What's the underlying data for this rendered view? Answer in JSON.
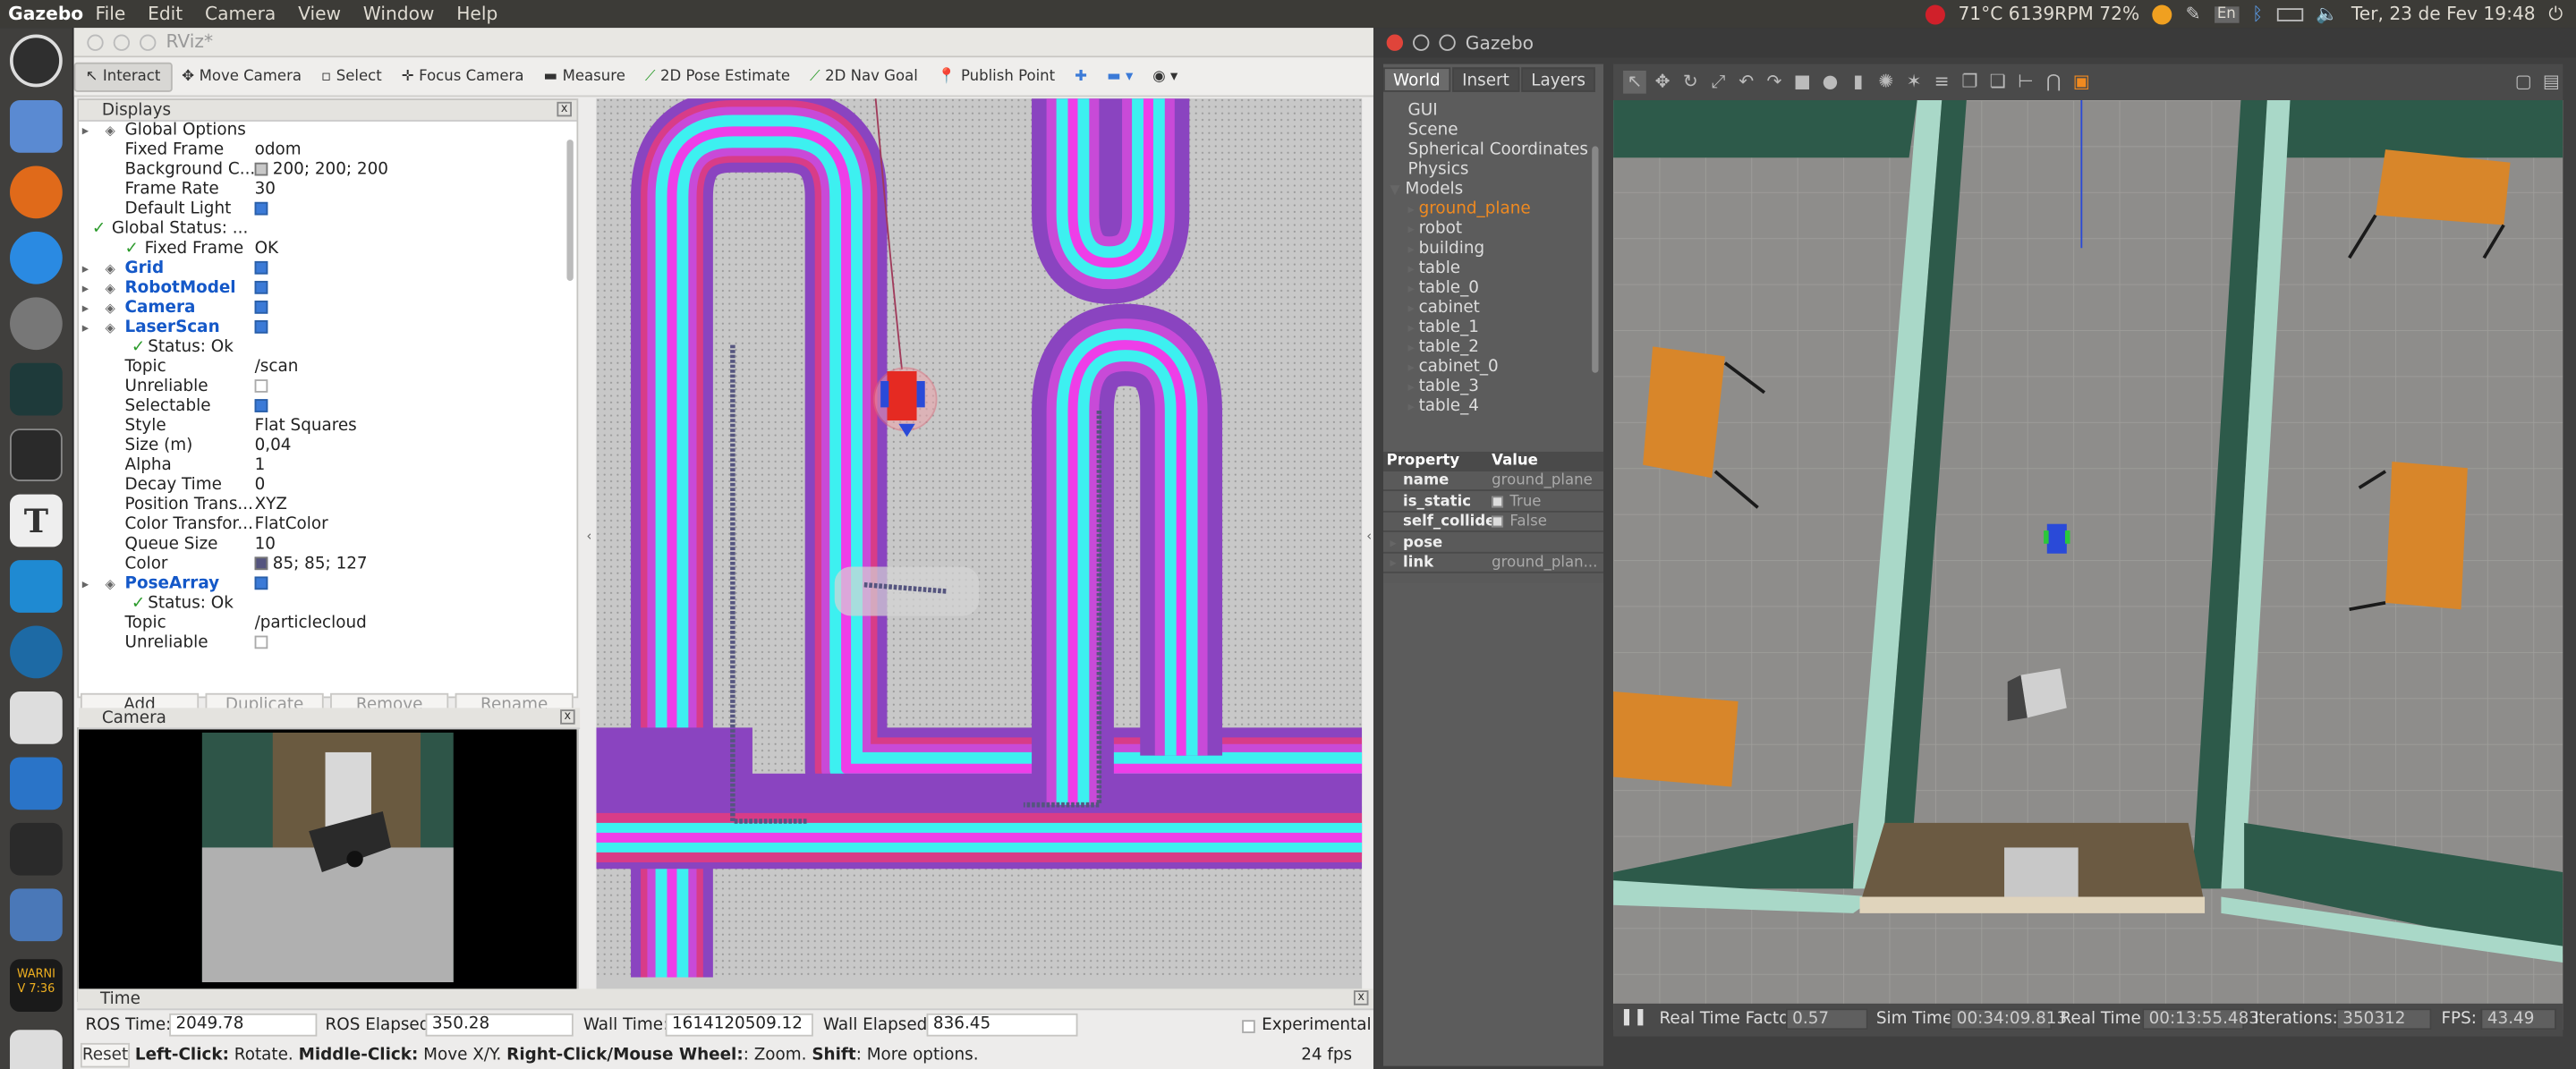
{
  "topbar": {
    "app": "Gazebo",
    "menus": [
      "File",
      "Edit",
      "Camera",
      "View",
      "Window",
      "Help"
    ],
    "sensors": "71°C 6139RPM 72%",
    "keyboard": "En",
    "datetime": "Ter, 23 de Fev 19:48"
  },
  "launcher": {
    "icons": [
      "ubuntu-dash-icon",
      "files-icon",
      "firefox-icon",
      "app-store-icon",
      "settings-icon",
      "system-monitor-icon",
      "terminal-icon",
      "text-editor-icon",
      "vscode-icon",
      "inkscape-icon",
      "gedit-icon",
      "thunderbird-icon",
      "geogebra-icon",
      "screenshot-icon",
      "warning-icon",
      "monitor-icon"
    ],
    "warning_text": "WARNI\nV 7:36"
  },
  "rviz": {
    "title": "RViz*",
    "toolbar": [
      "Interact",
      "Move Camera",
      "Select",
      "Focus Camera",
      "Measure",
      "2D Pose Estimate",
      "2D Nav Goal",
      "Publish Point"
    ],
    "displays_title": "Displays",
    "rows": [
      {
        "k": "Global Options",
        "v": "",
        "t": "section"
      },
      {
        "k": "Fixed Frame",
        "v": "odom"
      },
      {
        "k": "Background C...",
        "v": "200; 200; 200",
        "swatch": "#c8c8c8"
      },
      {
        "k": "Frame Rate",
        "v": "30"
      },
      {
        "k": "Default Light",
        "v": "",
        "cb": true
      },
      {
        "k": "Global Status: ...",
        "v": "",
        "t": "check"
      },
      {
        "k": "Fixed Frame",
        "v": "OK",
        "t": "check2"
      },
      {
        "k": "Grid",
        "v": "",
        "t": "blue",
        "cb": true
      },
      {
        "k": "RobotModel",
        "v": "",
        "t": "blue",
        "cb": true
      },
      {
        "k": "Camera",
        "v": "",
        "t": "blue",
        "cb": true
      },
      {
        "k": "LaserScan",
        "v": "",
        "t": "blue",
        "cb": true
      },
      {
        "k": "Status: Ok",
        "v": "",
        "t": "check3"
      },
      {
        "k": "Topic",
        "v": "/scan"
      },
      {
        "k": "Unreliable",
        "v": "",
        "cbe": true
      },
      {
        "k": "Selectable",
        "v": "",
        "cb": true
      },
      {
        "k": "Style",
        "v": "Flat Squares"
      },
      {
        "k": "Size (m)",
        "v": "0,04"
      },
      {
        "k": "Alpha",
        "v": "1"
      },
      {
        "k": "Decay Time",
        "v": "0"
      },
      {
        "k": "Position Trans...",
        "v": "XYZ"
      },
      {
        "k": "Color Transfor...",
        "v": "FlatColor"
      },
      {
        "k": "Queue Size",
        "v": "10"
      },
      {
        "k": "Color",
        "v": "85; 85; 127",
        "swatch": "#55557f"
      },
      {
        "k": "PoseArray",
        "v": "",
        "t": "blue",
        "cb": true
      },
      {
        "k": "Status: Ok",
        "v": "",
        "t": "check3"
      },
      {
        "k": "Topic",
        "v": "/particlecloud"
      },
      {
        "k": "Unreliable",
        "v": "",
        "cbe": true
      }
    ],
    "buttons": [
      "Add",
      "Duplicate",
      "Remove",
      "Rename"
    ],
    "camera_title": "Camera",
    "time_title": "Time",
    "ros_time_label": "ROS Time:",
    "ros_time": "2049.78",
    "ros_elapsed_label": "ROS Elapsed:",
    "ros_elapsed": "350.28",
    "wall_time_label": "Wall Time:",
    "wall_time": "1614120509.12",
    "wall_elapsed_label": "Wall Elapsed:",
    "wall_elapsed": "836.45",
    "experimental": "Experimental",
    "reset": "Reset",
    "hint_1": "Left-Click:",
    "hint_1b": " Rotate. ",
    "hint_2": "Middle-Click:",
    "hint_2b": " Move X/Y. ",
    "hint_3": "Right-Click/Mouse Wheel:",
    "hint_3b": ": Zoom. ",
    "hint_4": "Shift",
    "hint_4b": ": More options.",
    "fps": "24 fps"
  },
  "gazebo": {
    "title": "Gazebo",
    "tabs": [
      "World",
      "Insert",
      "Layers"
    ],
    "tree": [
      "GUI",
      "Scene",
      "Spherical Coordinates",
      "Physics",
      "Models"
    ],
    "models": [
      "ground_plane",
      "robot",
      "building",
      "table",
      "table_0",
      "cabinet",
      "table_1",
      "table_2",
      "cabinet_0",
      "table_3",
      "table_4"
    ],
    "prop_header": "Property",
    "value_header": "Value",
    "props": [
      {
        "k": "name",
        "v": "ground_plane"
      },
      {
        "k": "is_static",
        "v": "True",
        "cb": true
      },
      {
        "k": "self_collide",
        "v": "False",
        "cb": false
      },
      {
        "k": "pose",
        "v": "",
        "section": true
      },
      {
        "k": "link",
        "v": "ground_plan...",
        "section": true
      }
    ],
    "rtf_label": "Real Time Factor:",
    "rtf": "0.57",
    "sim_label": "Sim Time:",
    "sim": "00:34:09.813",
    "real_label": "Real Time:",
    "real": "00:13:55.483",
    "iter_label": "Iterations:",
    "iter": "350312",
    "fps_label": "FPS:",
    "fps": "43.49"
  },
  "colors": {
    "cyan": "#3df0f0",
    "magenta": "#ee3ee8",
    "purple": "#8c4cc8",
    "red": "#e84a5a",
    "floor": "#8e8d8b",
    "wall": "#a9d8c8"
  }
}
